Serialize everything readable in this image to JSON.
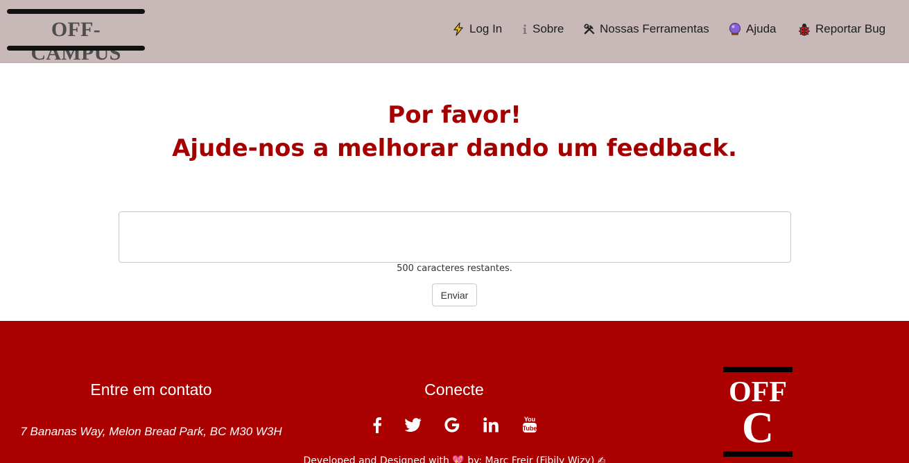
{
  "header": {
    "logo_text": "OFF-CAMPUS",
    "nav": [
      {
        "label": "Log In",
        "icon": "lightning-icon"
      },
      {
        "label": "Sobre",
        "icon": "info-icon"
      },
      {
        "label": "Nossas Ferramentas",
        "icon": "tools-icon"
      },
      {
        "label": "Ajuda",
        "icon": "crystal-ball-icon"
      },
      {
        "label": "Reportar Bug",
        "icon": "ladybug-icon"
      }
    ]
  },
  "main": {
    "heading_line1": "Por favor!",
    "heading_line2": "Ajude-nos a melhorar dando um feedback.",
    "feedback_value": "",
    "chars_remaining": "500 caracteres restantes.",
    "submit_label": "Enviar"
  },
  "footer": {
    "contact_title": "Entre em contato",
    "address": "7 Bananas Way, Melon Bread Park, BC M30 W3H",
    "connect_title": "Conecte",
    "socials": [
      "facebook-icon",
      "twitter-icon",
      "google-icon",
      "linkedin-icon",
      "youtube-icon"
    ],
    "credits": "Developed and Designed with 💖 by: Marc Freir (Fibily Wizy) ✍",
    "logo_line1": "OFF",
    "logo_line2": "C"
  },
  "colors": {
    "header_bg": "#c8b9b8",
    "accent_red": "#a50000",
    "footer_bg": "#aa0000"
  }
}
